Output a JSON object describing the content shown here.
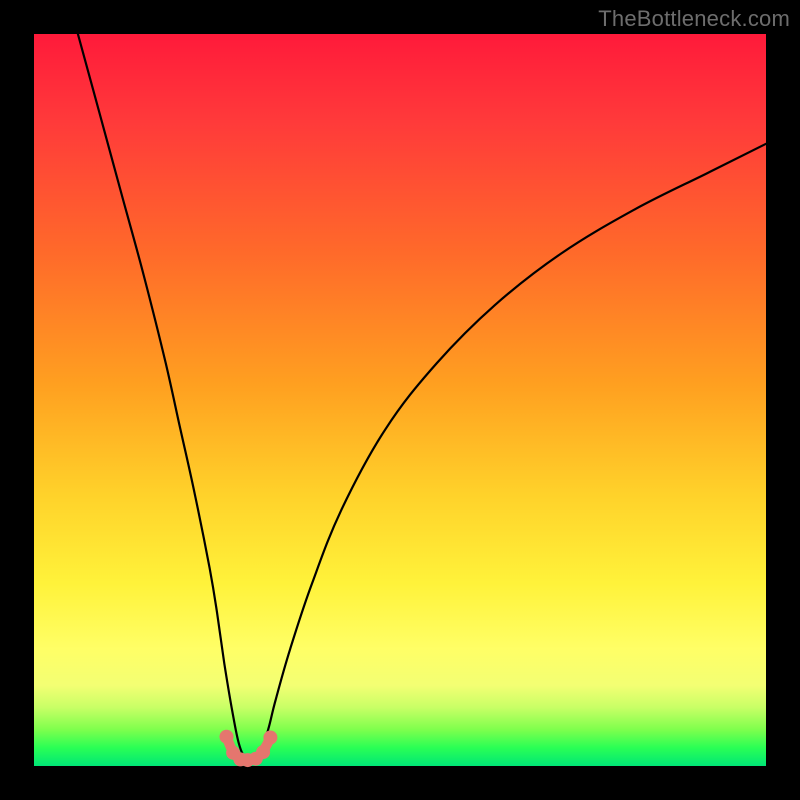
{
  "watermark": "TheBottleneck.com",
  "chart_data": {
    "type": "line",
    "title": "",
    "xlabel": "",
    "ylabel": "",
    "xlim": [
      0,
      100
    ],
    "ylim": [
      0,
      100
    ],
    "grid": false,
    "legend": false,
    "series": [
      {
        "name": "bottleneck-curve",
        "color": "#000000",
        "x": [
          6,
          9,
          12,
          15,
          18,
          20,
          22,
          24,
          25,
          26,
          27,
          28,
          29,
          30,
          31,
          32,
          33,
          35,
          38,
          42,
          48,
          55,
          63,
          72,
          82,
          92,
          100
        ],
        "y": [
          100,
          89,
          78,
          67,
          55,
          46,
          37,
          27,
          21,
          14,
          8,
          3,
          1,
          1,
          2,
          5,
          9,
          16,
          25,
          35,
          46,
          55,
          63,
          70,
          76,
          81,
          85
        ]
      },
      {
        "name": "highlight-dots",
        "color": "#e5766e",
        "type": "scatter",
        "x": [
          26.3,
          27.2,
          28.2,
          29.2,
          30.3,
          31.3,
          32.3
        ],
        "y": [
          4.0,
          1.8,
          0.9,
          0.8,
          1.0,
          1.9,
          3.9
        ]
      },
      {
        "name": "highlight-arc",
        "color": "#e5766e",
        "type": "line",
        "x": [
          26.3,
          27.0,
          27.8,
          28.6,
          29.4,
          30.2,
          31.0,
          31.7,
          32.3
        ],
        "y": [
          4.0,
          2.3,
          1.2,
          0.8,
          0.8,
          1.0,
          1.6,
          2.7,
          3.9
        ]
      }
    ]
  },
  "colors": {
    "background": "#000000",
    "gradient_top": "#ff1a3a",
    "gradient_bottom": "#00e676",
    "curve": "#000000",
    "highlight": "#e5766e",
    "watermark": "#6d6d6d"
  }
}
